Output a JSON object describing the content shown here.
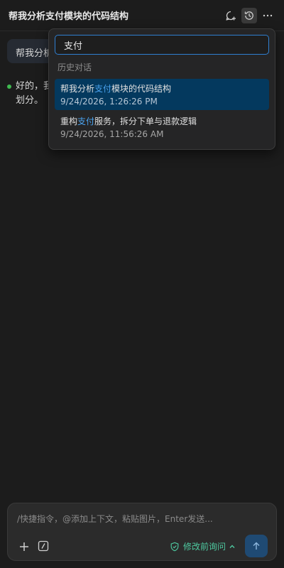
{
  "header": {
    "title": "帮我分析支付模块的代码结构"
  },
  "conversation": {
    "user_message": "帮我分析支付模块的代码结构",
    "assistant_line1": "好的，我",
    "assistant_line2": "划分。"
  },
  "history": {
    "search_value": "支付",
    "section_label": "历史对话",
    "items": [
      {
        "title_before": "帮我分析",
        "title_match": "支付",
        "title_after": "模块的代码结构",
        "date": "9/24/2026, 1:26:26 PM",
        "selected": true
      },
      {
        "title_before": "重构",
        "title_match": "支付",
        "title_after": "服务，拆分下单与退款逻辑",
        "date": "9/24/2026, 11:56:26 AM",
        "selected": false
      }
    ]
  },
  "composer": {
    "placeholder": "/快捷指令，@添加上下文，粘贴图片，Enter发送...",
    "mode_label": "修改前询问"
  },
  "colors": {
    "accent": "#2f7fd1",
    "selected_bg": "#04395e",
    "highlight": "#4aa3f0",
    "mode_green": "#4ec9a0",
    "status_dot": "#3fb950"
  }
}
